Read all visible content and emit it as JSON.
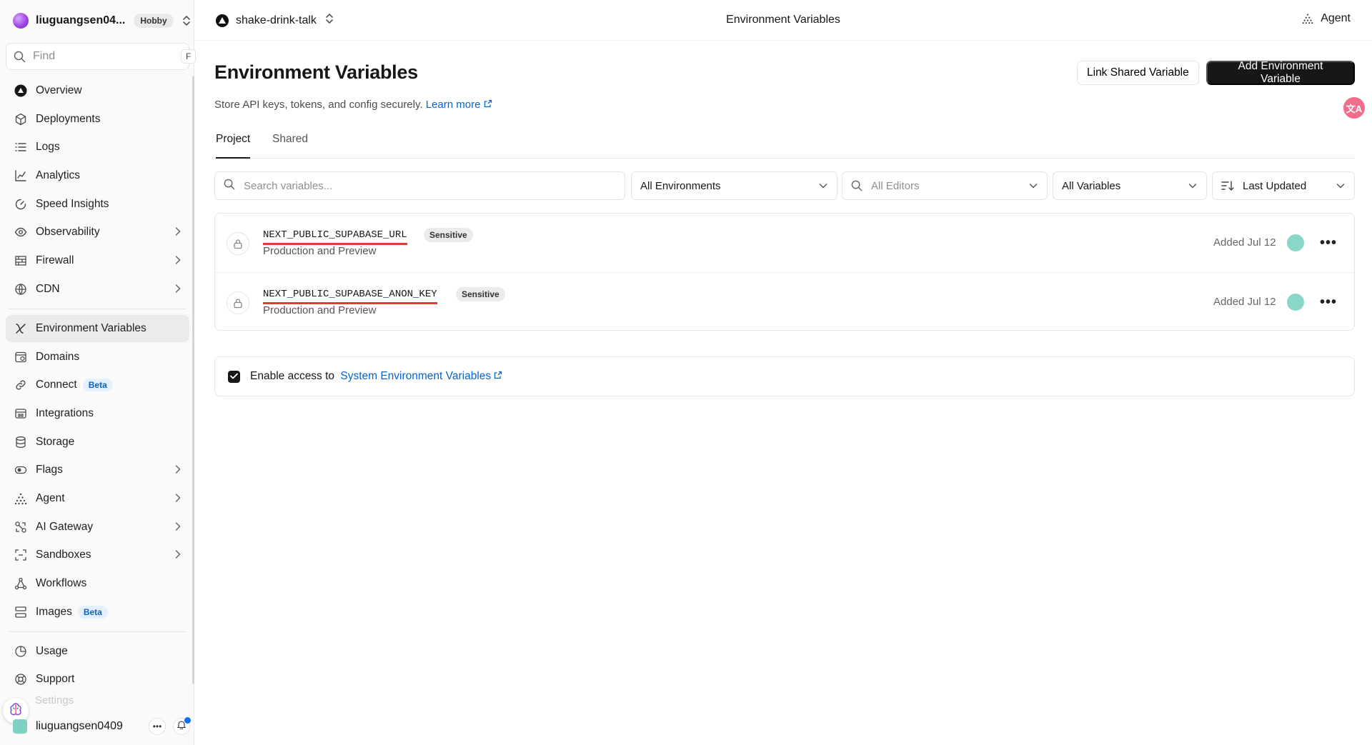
{
  "team": {
    "name": "liuguangsen04...",
    "plan": "Hobby"
  },
  "search": {
    "placeholder": "Find",
    "shortcut": "F"
  },
  "sidebar": {
    "items": [
      {
        "label": "Overview"
      },
      {
        "label": "Deployments"
      },
      {
        "label": "Logs"
      },
      {
        "label": "Analytics"
      },
      {
        "label": "Speed Insights"
      },
      {
        "label": "Observability"
      },
      {
        "label": "Firewall"
      },
      {
        "label": "CDN"
      },
      {
        "label": "Environment Variables"
      },
      {
        "label": "Domains"
      },
      {
        "label": "Connect",
        "badge": "Beta"
      },
      {
        "label": "Integrations"
      },
      {
        "label": "Storage"
      },
      {
        "label": "Flags"
      },
      {
        "label": "Agent"
      },
      {
        "label": "AI Gateway"
      },
      {
        "label": "Sandboxes"
      },
      {
        "label": "Workflows"
      },
      {
        "label": "Images",
        "badge": "Beta"
      }
    ],
    "bottom_items": [
      {
        "label": "Usage"
      },
      {
        "label": "Support"
      },
      {
        "label": "Settings"
      }
    ],
    "active_item": "Environment Variables"
  },
  "user": {
    "name": "liuguangsen0409"
  },
  "topbar": {
    "project": "shake-drink-talk",
    "title": "Environment Variables",
    "agent_label": "Agent"
  },
  "page": {
    "title": "Environment Variables",
    "subtitle": "Store API keys, tokens, and config securely.",
    "learn_more": "Learn more",
    "link_shared_label": "Link Shared Variable",
    "add_label": "Add Environment Variable"
  },
  "tabs": [
    {
      "label": "Project",
      "active": true
    },
    {
      "label": "Shared",
      "active": false
    }
  ],
  "filters": {
    "search_placeholder": "Search variables...",
    "environments": "All Environments",
    "editors_placeholder": "All Editors",
    "variables": "All Variables",
    "sort": "Last Updated"
  },
  "variables": [
    {
      "name": "NEXT_PUBLIC_SUPABASE_URL",
      "badge": "Sensitive",
      "environments": "Production and Preview",
      "added": "Added Jul 12"
    },
    {
      "name": "NEXT_PUBLIC_SUPABASE_ANON_KEY",
      "badge": "Sensitive",
      "environments": "Production and Preview",
      "added": "Added Jul 12"
    }
  ],
  "system_vars": {
    "label": "Enable access to",
    "link": "System Environment Variables",
    "checked": true
  },
  "colors": {
    "accent": "#0a63c9",
    "primary_button": "#171717",
    "highlight_underline": "#e03a3a"
  }
}
